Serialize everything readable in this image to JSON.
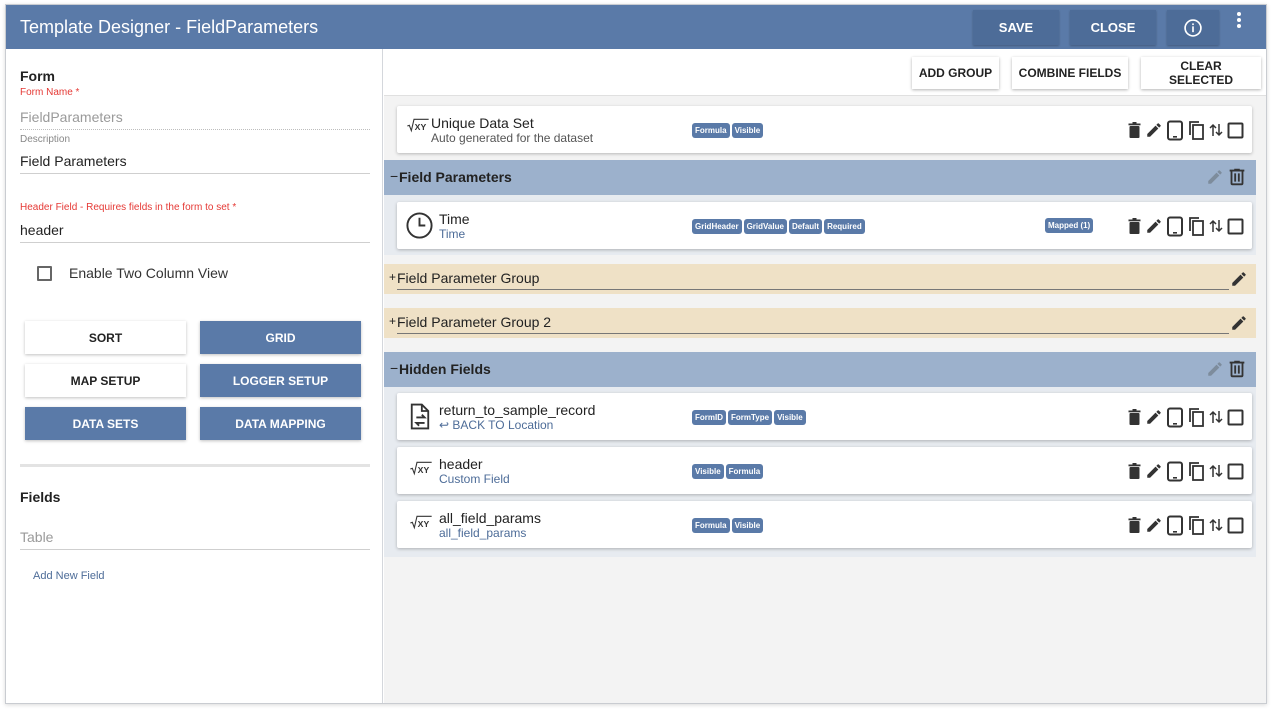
{
  "header": {
    "title": "Template Designer - FieldParameters",
    "save_label": "SAVE",
    "close_label": "CLOSE",
    "info_icon": "info-icon",
    "more_icon": "more-vert-icon"
  },
  "form": {
    "section_title": "Form",
    "form_name_label": "Form Name *",
    "form_name_value": "FieldParameters",
    "description_label": "Description",
    "description_value": "Field Parameters",
    "header_field_label": "Header Field - Requires fields in the form to set *",
    "header_field_value": "header",
    "two_column_label": "Enable Two Column View",
    "two_column_checked": false
  },
  "buttons": {
    "sort": "SORT",
    "grid": "GRID",
    "map_setup": "MAP SETUP",
    "logger_setup": "LOGGER SETUP",
    "data_sets": "DATA SETS",
    "data_mapping": "DATA MAPPING"
  },
  "fields": {
    "section_title": "Fields",
    "search_placeholder": "Table",
    "add_new_label": "Add New Field"
  },
  "toolbar": {
    "add_group": "ADD GROUP",
    "combine_fields": "COMBINE FIELDS",
    "clear_selected": "CLEAR SELECTED"
  },
  "canvas": {
    "unique": {
      "name": "Unique Data Set",
      "sub": "Auto generated for the dataset",
      "badges": [
        "Formula",
        "Visible"
      ]
    },
    "group1": {
      "toggle": "−",
      "title": "Field Parameters",
      "items": [
        {
          "name": "Time",
          "sub": "Time",
          "badges": [
            "GridHeader",
            "GridValue",
            "Default",
            "Required"
          ],
          "mapped": "Mapped (1)"
        }
      ],
      "subgroups": [
        {
          "toggle": "+",
          "title": "Field Parameter Group"
        },
        {
          "toggle": "+",
          "title": "Field Parameter Group 2"
        }
      ]
    },
    "group2": {
      "toggle": "−",
      "title": "Hidden Fields",
      "items": [
        {
          "name": "return_to_sample_record",
          "sub": "↩ BACK TO Location",
          "badges": [
            "FormID",
            "FormType",
            "Visible"
          ]
        },
        {
          "name": "header",
          "sub": "Custom Field",
          "badges": [
            "Visible",
            "Formula"
          ]
        },
        {
          "name": "all_field_params",
          "sub": "all_field_params",
          "badges": [
            "Formula",
            "Visible"
          ]
        }
      ]
    }
  },
  "colors": {
    "primary": "#5a7aa8",
    "group_header": "#9cb1cc",
    "subgroup": "#efe1c6",
    "required": "#e53935"
  }
}
